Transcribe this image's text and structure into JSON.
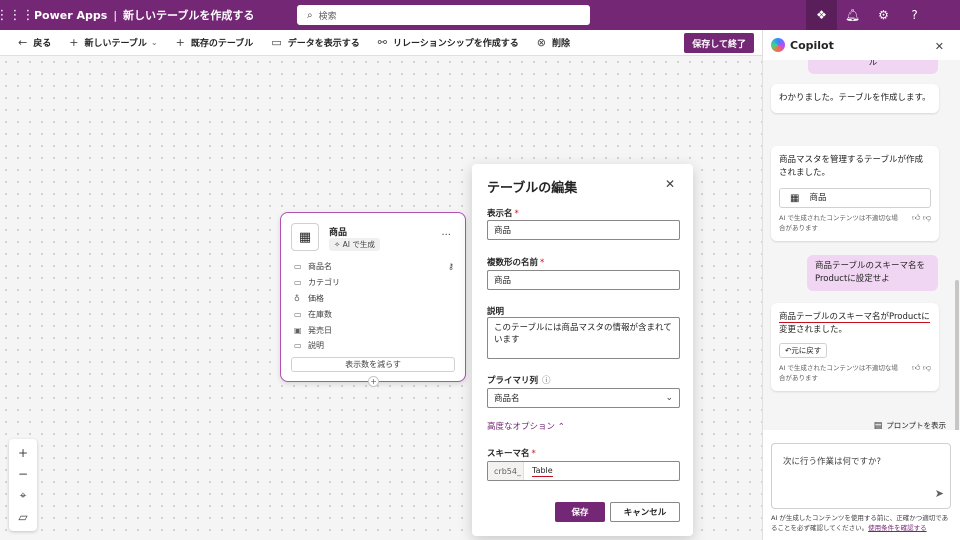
{
  "header": {
    "app_name": "Power Apps",
    "separator": "|",
    "page_title": "新しいテーブルを作成する",
    "search_placeholder": "検索",
    "icons": [
      "waffle-icon",
      "copilot-icon",
      "bell-icon",
      "gear-icon",
      "help-icon"
    ]
  },
  "toolbar": {
    "back": "戻る",
    "new_table": "新しいテーブル",
    "existing_table": "既存のテーブル",
    "show_data": "データを表示する",
    "create_relationship": "リレーションシップを作成する",
    "delete": "削除",
    "save_exit": "保存して終了"
  },
  "table_card": {
    "title": "商品",
    "badge": "AI で生成",
    "more": "...",
    "columns": [
      {
        "label": "商品名",
        "icon": "text-icon",
        "primary": true
      },
      {
        "label": "カテゴリ",
        "icon": "choice-icon",
        "primary": false
      },
      {
        "label": "価格",
        "icon": "currency-icon",
        "primary": false
      },
      {
        "label": "在庫数",
        "icon": "number-icon",
        "primary": false
      },
      {
        "label": "発売日",
        "icon": "calendar-icon",
        "primary": false
      },
      {
        "label": "説明",
        "icon": "text-icon",
        "primary": false
      }
    ],
    "show_less": "表示数を減らす"
  },
  "edit_panel": {
    "title": "テーブルの編集",
    "display_name_label": "表示名",
    "display_name_value": "商品",
    "plural_name_label": "複数形の名前",
    "plural_name_value": "商品",
    "description_label": "説明",
    "description_value": "このテーブルには商品マスタの情報が含まれています",
    "primary_column_label": "プライマリ列",
    "primary_column_value": "商品名",
    "advanced_options": "高度なオプション",
    "schema_name_label": "スキーマ名",
    "schema_prefix": "crb54_",
    "schema_value": "Table",
    "required_mark": "*",
    "save": "保存",
    "cancel": "キャンセル"
  },
  "copilot": {
    "title": "Copilot",
    "messages": {
      "user_top_fragment": "ル",
      "bot_1": "わかりました。テーブルを作成します。",
      "bot_2": "商品マスタを管理するテーブルが作成されました。",
      "bot_2_chip": "商品",
      "ai_note": "AI で生成されたコンテンツは不適切な場合があります",
      "user_2": "商品テーブルのスキーマ名をProductに設定せよ",
      "bot_3_underlined": "商品テーブルのスキーマ名がProductに",
      "bot_3_rest": "変更されました。",
      "undo": "元に戻す"
    },
    "show_prompts": "プロンプトを表示",
    "input_placeholder": "次に行う作業は何ですか?",
    "footer_text": "AI が生成したコンテンツを使用する前に、正確かつ適切であることを必ず確認してください。",
    "footer_link": "使用条件を確認する"
  }
}
